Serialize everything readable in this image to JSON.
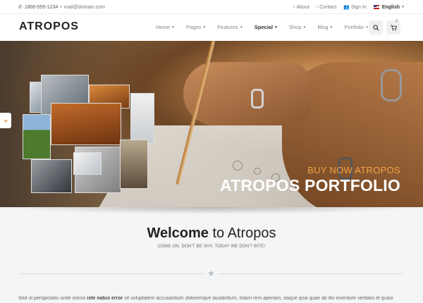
{
  "topbar": {
    "phone": "1800-555-1234",
    "separator": "•",
    "email": "mail@domain.com",
    "about": "About",
    "contact": "Contact",
    "signin": "Sign In",
    "language": "English"
  },
  "header": {
    "logo": "ATROPOS",
    "nav": [
      "Home",
      "Pages",
      "Features",
      "Special",
      "Shop",
      "Blog",
      "Portfolio"
    ],
    "active_nav": "Special",
    "cart_count": "3"
  },
  "hero": {
    "subtitle": "BUY NOW ATROPOS",
    "title": "ATROPOS PORTFOLIO",
    "side_tab": "»"
  },
  "welcome": {
    "title_bold": "Welcome",
    "title_rest": " to Atropos",
    "tagline": "COME ON, DON'T BE SHY, TODAY WE DON'T BITE!"
  },
  "body": {
    "part1": "Sed ut perspiciatis unde omnis ",
    "bold": "iste natus error",
    "part2": " sit voluptatem accusantium ",
    "italic": "doloremque laudantium",
    "part3": ", totam rem aperiam, eaque ipsa quae ab illo inventore veritatis et quasi"
  },
  "colors": {
    "accent": "#f2a444",
    "background": "#f4f5f6"
  }
}
